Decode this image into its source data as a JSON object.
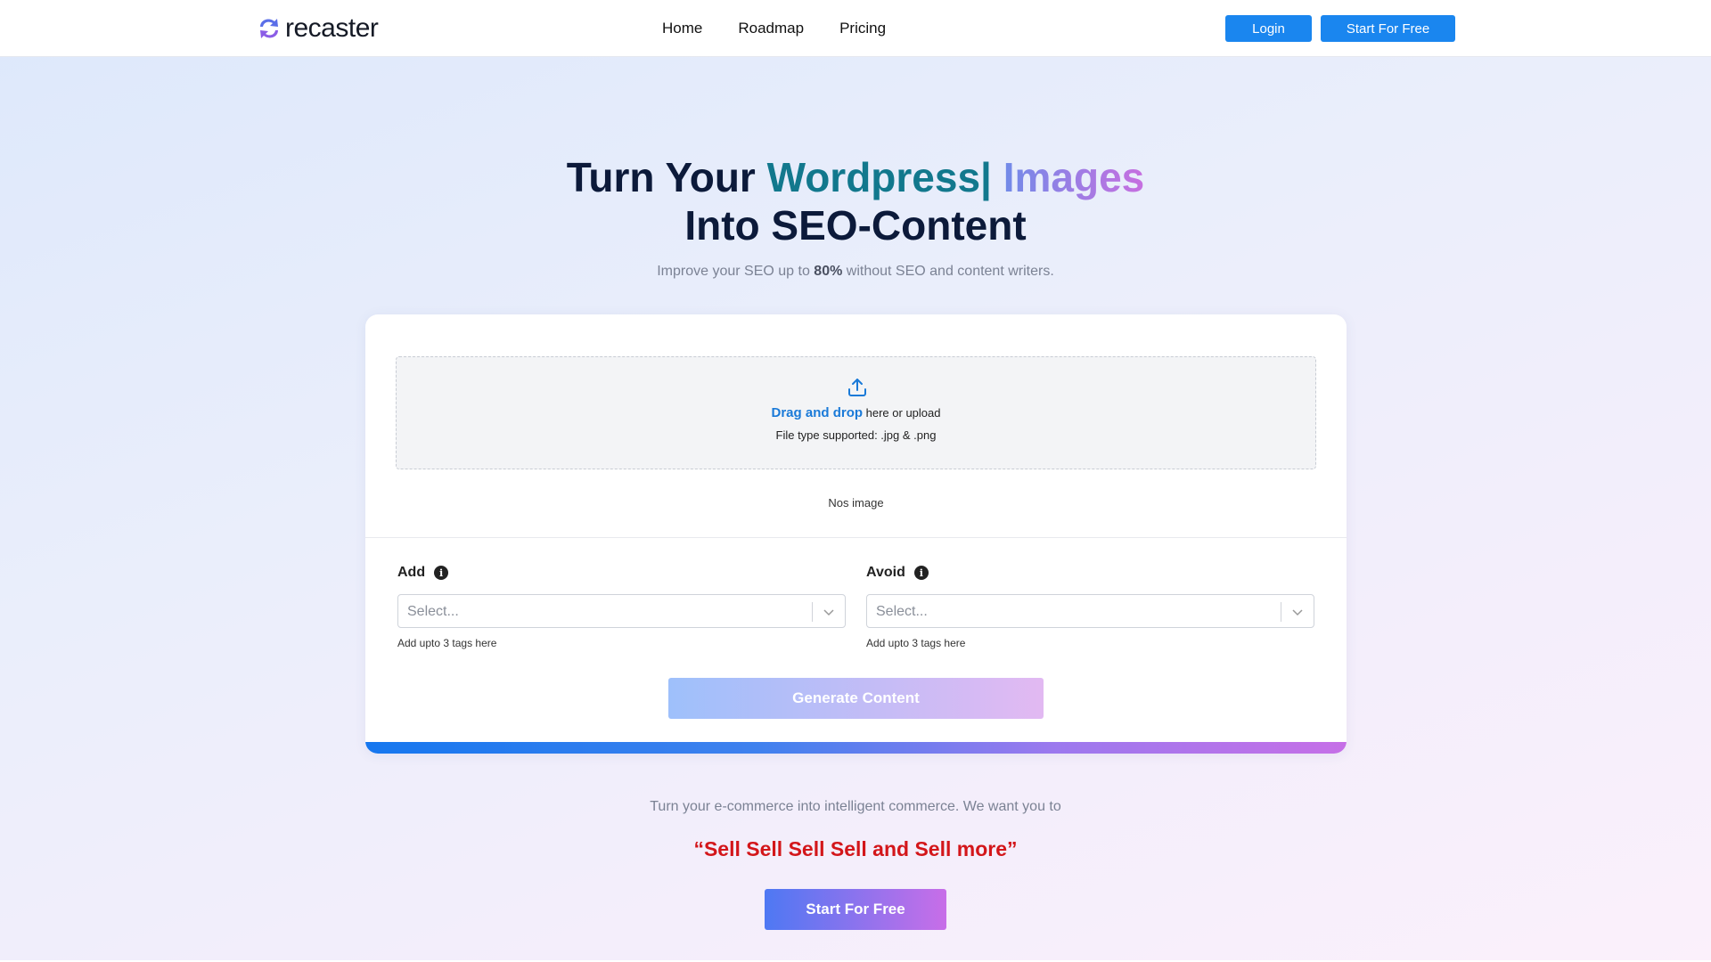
{
  "header": {
    "logo_text": "recaster",
    "nav": [
      "Home",
      "Roadmap",
      "Pricing"
    ],
    "login_label": "Login",
    "start_label": "Start For Free"
  },
  "hero": {
    "title_part1": "Turn Your ",
    "title_highlight1": "Wordpress|",
    "title_highlight2": " Images",
    "title_line2": "Into SEO-Content",
    "subtitle_pre": "Improve your SEO up to ",
    "subtitle_bold": "80%",
    "subtitle_post": " without SEO and content writers."
  },
  "upload": {
    "drag_text": "Drag and drop",
    "upload_text": " here or upload",
    "file_types": "File type supported: .jpg & .png",
    "status": "Nos image"
  },
  "fields": {
    "add": {
      "label": "Add",
      "placeholder": "Select...",
      "hint": "Add upto 3 tags here"
    },
    "avoid": {
      "label": "Avoid",
      "placeholder": "Select...",
      "hint": "Add upto 3 tags here"
    }
  },
  "generate_label": "Generate Content",
  "bottom": {
    "tagline": "Turn your e-commerce into intelligent commerce. We want you to",
    "quote": "“Sell Sell Sell Sell and Sell more”",
    "cta": "Start For Free"
  },
  "colors": {
    "primary": "#1a86ef",
    "quote": "#d3161a",
    "title": "#0c1a3a",
    "highlight1": "#12788d",
    "gradient_start": "#6a8de9",
    "gradient_end": "#c76fe0"
  }
}
